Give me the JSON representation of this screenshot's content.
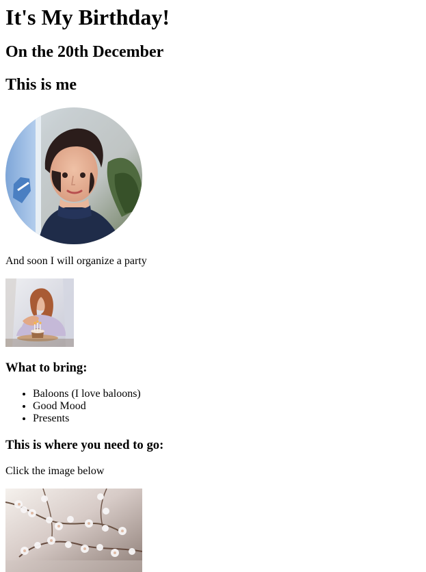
{
  "title": "It's My Birthday!",
  "date_heading": "On the 20th December",
  "me_heading": "This is me",
  "party_text": "And soon I will organize a party",
  "bring_heading": "What to bring:",
  "bring_items": [
    "Baloons (I love baloons)",
    "Good Mood",
    "Presents"
  ],
  "location_heading": "This is where you need to go:",
  "click_text": "Click the image below",
  "icons": {
    "portrait": "portrait-photo",
    "party": "birthday-cake-photo",
    "map": "cherry-blossom-photo"
  }
}
